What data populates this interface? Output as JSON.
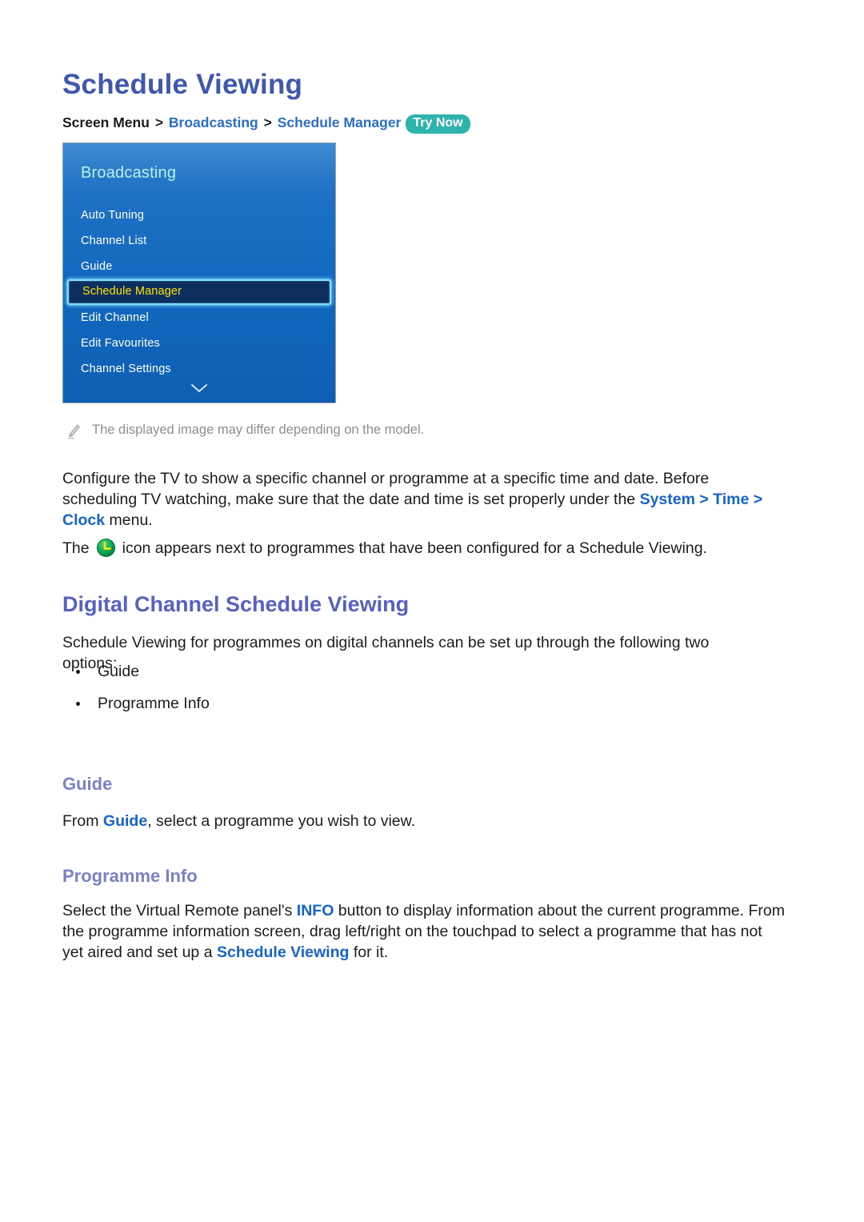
{
  "page": {
    "title": "Schedule Viewing"
  },
  "breadcrumb": {
    "root": "Screen Menu",
    "sep1": ">",
    "level1": "Broadcasting",
    "sep2": ">",
    "level2": "Schedule Manager",
    "badge": "Try Now"
  },
  "tv_menu": {
    "header": "Broadcasting",
    "items": [
      {
        "label": "Auto Tuning",
        "selected": false
      },
      {
        "label": "Channel List",
        "selected": false
      },
      {
        "label": "Guide",
        "selected": false
      },
      {
        "label": "Schedule Manager",
        "selected": true
      },
      {
        "label": "Edit Channel",
        "selected": false
      },
      {
        "label": "Edit Favourites",
        "selected": false
      },
      {
        "label": "Channel Settings",
        "selected": false
      }
    ],
    "scroll_indicator": "chevron-down-icon",
    "colors": {
      "background_top": "#3f8ad1",
      "background_bottom": "#0e5fb4",
      "header_text": "#b8f0ec",
      "selected_text": "#ffe400",
      "selected_fill": "#0c2f60",
      "selected_border": "#7fe3ff"
    }
  },
  "note": {
    "icon": "pencil-icon",
    "text": "The displayed image may differ depending on the model."
  },
  "paragraphs": {
    "configure": {
      "part1": "Configure the TV to show a specific channel or programme at a specific time and date. Before scheduling TV watching, make sure that the date and time is set properly under the ",
      "link1": "System",
      "sep1": " > ",
      "link2": "Time",
      "sep2": " > ",
      "link3": "Clock",
      "part2": " menu."
    },
    "icon_line": {
      "prefix": "The",
      "icon": "schedule-viewing-clock-icon",
      "suffix": "icon appears next to programmes that have been configured for a Schedule Viewing."
    },
    "digital_intro": "Schedule Viewing for programmes on digital channels can be set up through the following two options:",
    "guide_body": {
      "part1": "From ",
      "link1": "Guide",
      "part2": ", select a programme you wish to view."
    },
    "proginfo_body": {
      "part1": "Select the Virtual Remote panel's ",
      "link1": "INFO",
      "part2": " button to display information about the current programme. From the programme information screen, drag left/right on the touchpad to select a programme that has not yet aired and set up a ",
      "link2": "Schedule Viewing",
      "part3": " for it."
    }
  },
  "headings": {
    "h2_digital": "Digital Channel Schedule Viewing",
    "h3_guide": "Guide",
    "h3_proginfo": "Programme Info"
  },
  "bullets": [
    "Guide",
    "Programme Info"
  ],
  "colors": {
    "page_title": "#3f57ae",
    "h2": "#5661c0",
    "h3": "#7b82c4",
    "link": "#1565c8",
    "breadcrumb_link": "#2a6fc4",
    "badge": "#2cb3ab",
    "note_text": "#8d8d8d",
    "clock_icon_body": "#00a850",
    "clock_icon_hands": "#ffe400"
  }
}
